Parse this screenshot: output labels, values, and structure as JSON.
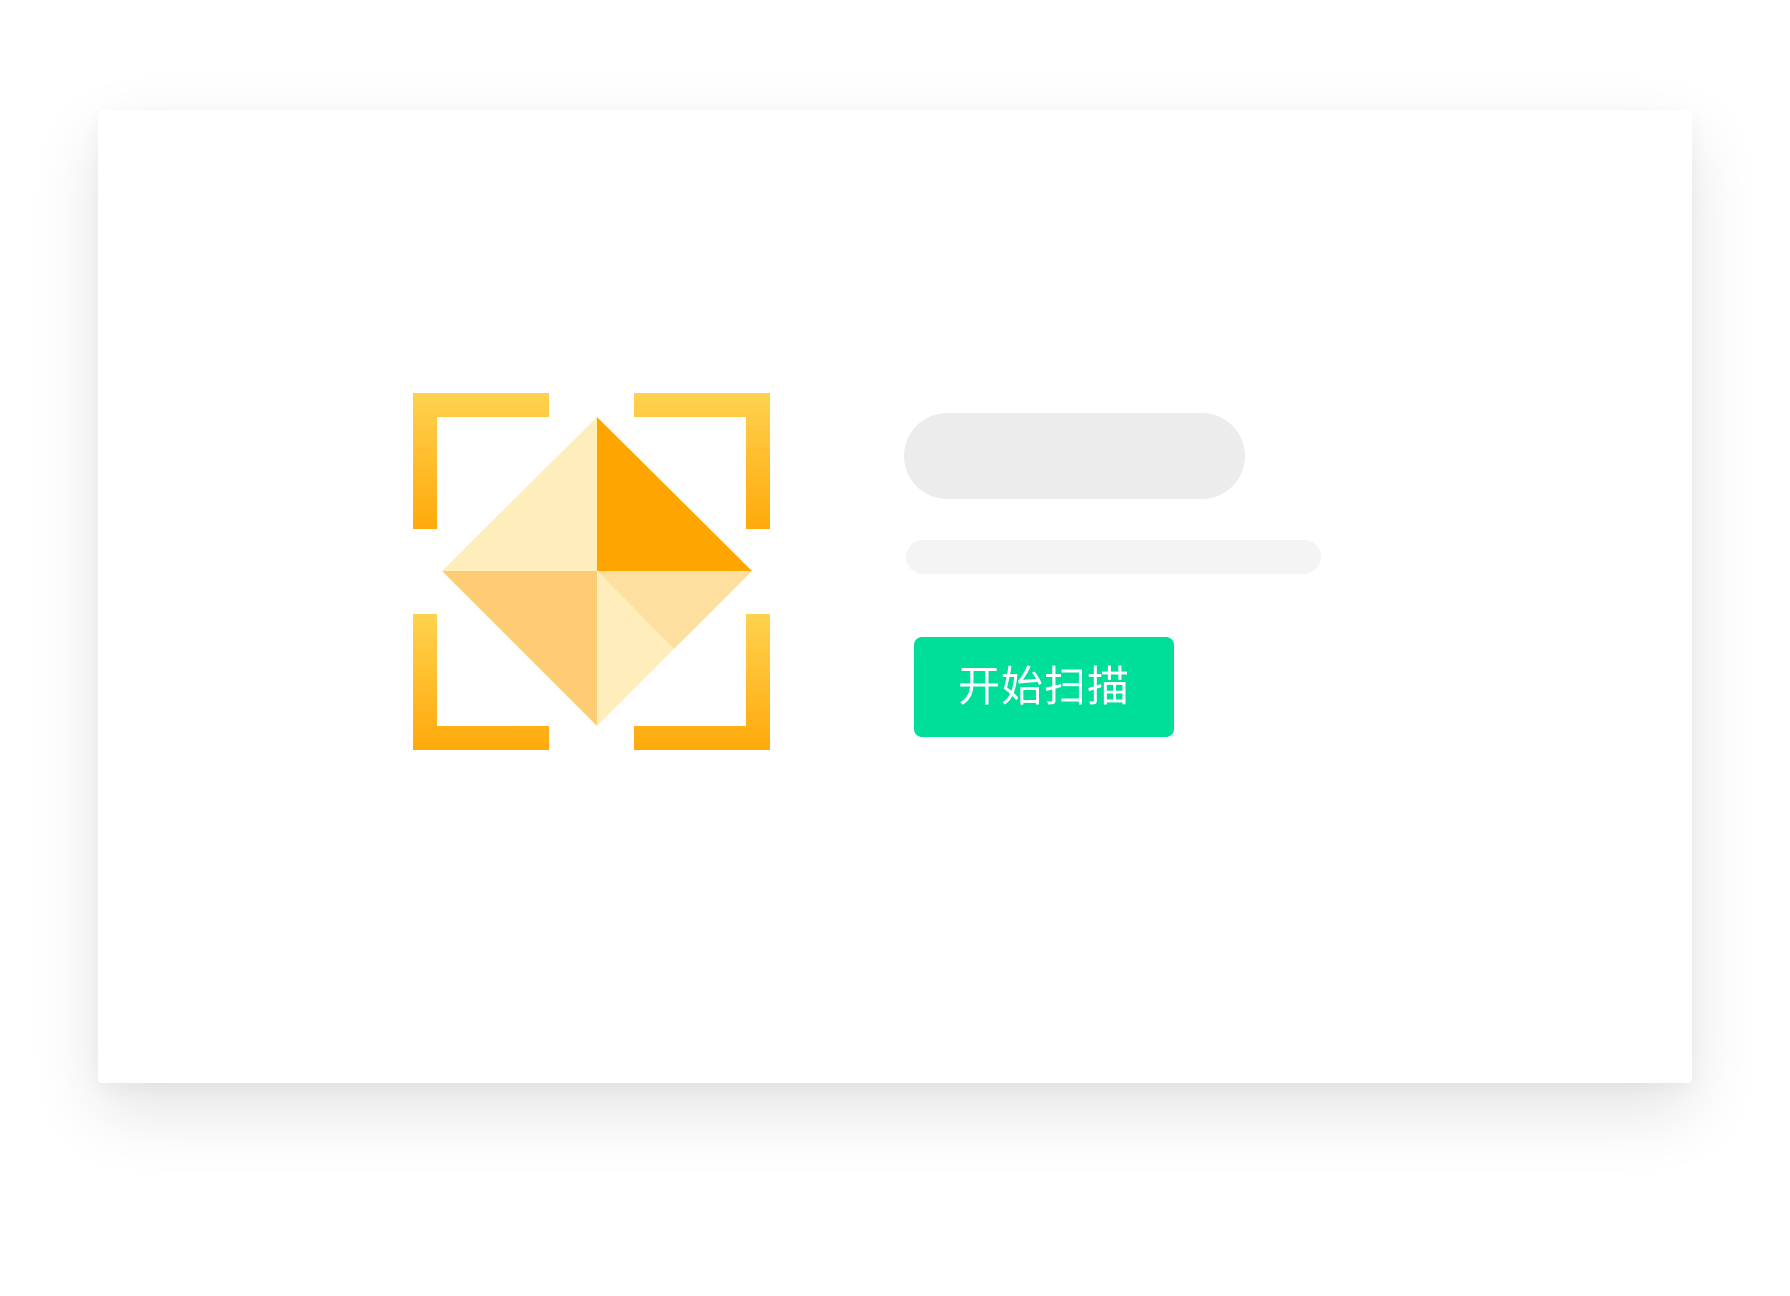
{
  "scan_panel": {
    "start_scan_label": "开始扫描"
  },
  "icons": {
    "scan_logo": "scan-frame-origami-icon"
  },
  "colors": {
    "button_green": "#00df9a",
    "frame_yellow_top": "#ffd24f",
    "frame_yellow_bottom": "#ffa90b",
    "origami_orange": "#ffa500",
    "origami_pale": "#fdeebb",
    "origami_light": "#fecc73",
    "origami_soft": "#fde09f",
    "skeleton_gray": "#ececec",
    "skeleton_light": "#f4f4f4"
  }
}
